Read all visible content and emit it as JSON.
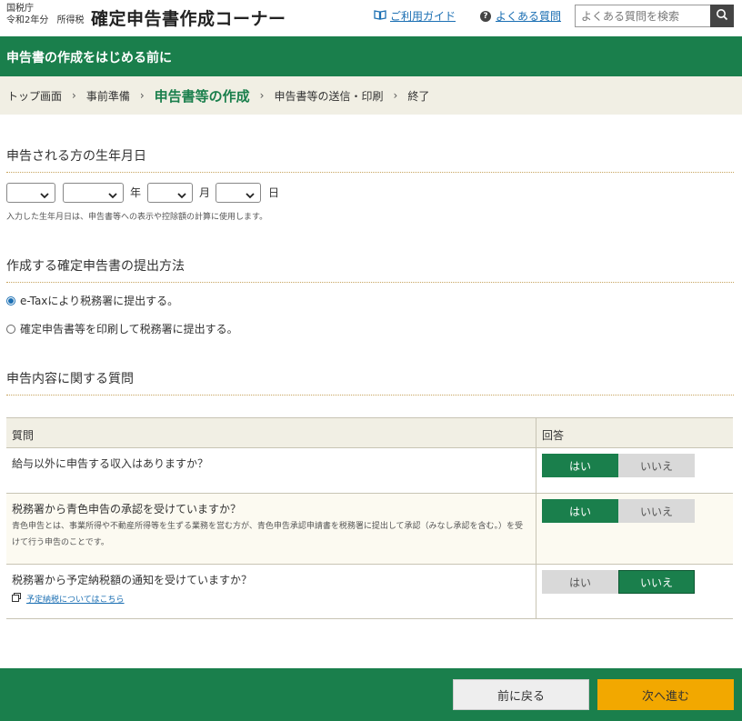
{
  "header": {
    "agency": "国税庁",
    "tax_year": "令和2年分",
    "tax_type": "所得税",
    "site_title": "確定申告書作成コーナー",
    "guide_link": "ご利用ガイド",
    "faq_link": "よくある質問",
    "search_placeholder": "よくある質問を検索"
  },
  "page_heading": "申告書の作成をはじめる前に",
  "breadcrumb": {
    "items": [
      "トップ画面",
      "事前準備",
      "申告書等の作成",
      "申告書等の送信・印刷",
      "終了"
    ],
    "current_index": 2
  },
  "birthdate": {
    "heading": "申告される方の生年月日",
    "era_value": "",
    "year_value": "",
    "month_value": "",
    "day_value": "",
    "year_unit": "年",
    "month_unit": "月",
    "day_unit": "日",
    "note": "入力した生年月日は、申告書等への表示や控除額の計算に使用します。"
  },
  "filing_method": {
    "heading": "作成する確定申告書の提出方法",
    "options": [
      {
        "label": "e-Taxにより税務署に提出する。",
        "selected": true
      },
      {
        "label": "確定申告書等を印刷して税務署に提出する。",
        "selected": false
      }
    ]
  },
  "questions": {
    "heading": "申告内容に関する質問",
    "col_question": "質問",
    "col_answer": "回答",
    "yes_label": "はい",
    "no_label": "いいえ",
    "rows": [
      {
        "question": "給与以外に申告する収入はありますか？",
        "answer": "yes"
      },
      {
        "question": "税務署から青色申告の承認を受けていますか？",
        "description": "青色申告とは、事業所得や不動産所得等を生ずる業務を営む方が、青色申告承認申請書を税務署に提出して承認（みなし承認を含む。）を受けて行う申告のことです。",
        "answer": "yes"
      },
      {
        "question": "税務署から予定納税額の通知を受けていますか？",
        "link": "予定納税についてはこちら",
        "answer": "no"
      }
    ]
  },
  "footer": {
    "back_label": "前に戻る",
    "next_label": "次へ進む"
  },
  "colors": {
    "brand_green": "#1a7f4c",
    "accent_orange": "#f2a800",
    "link_blue": "#1b6fb3"
  }
}
